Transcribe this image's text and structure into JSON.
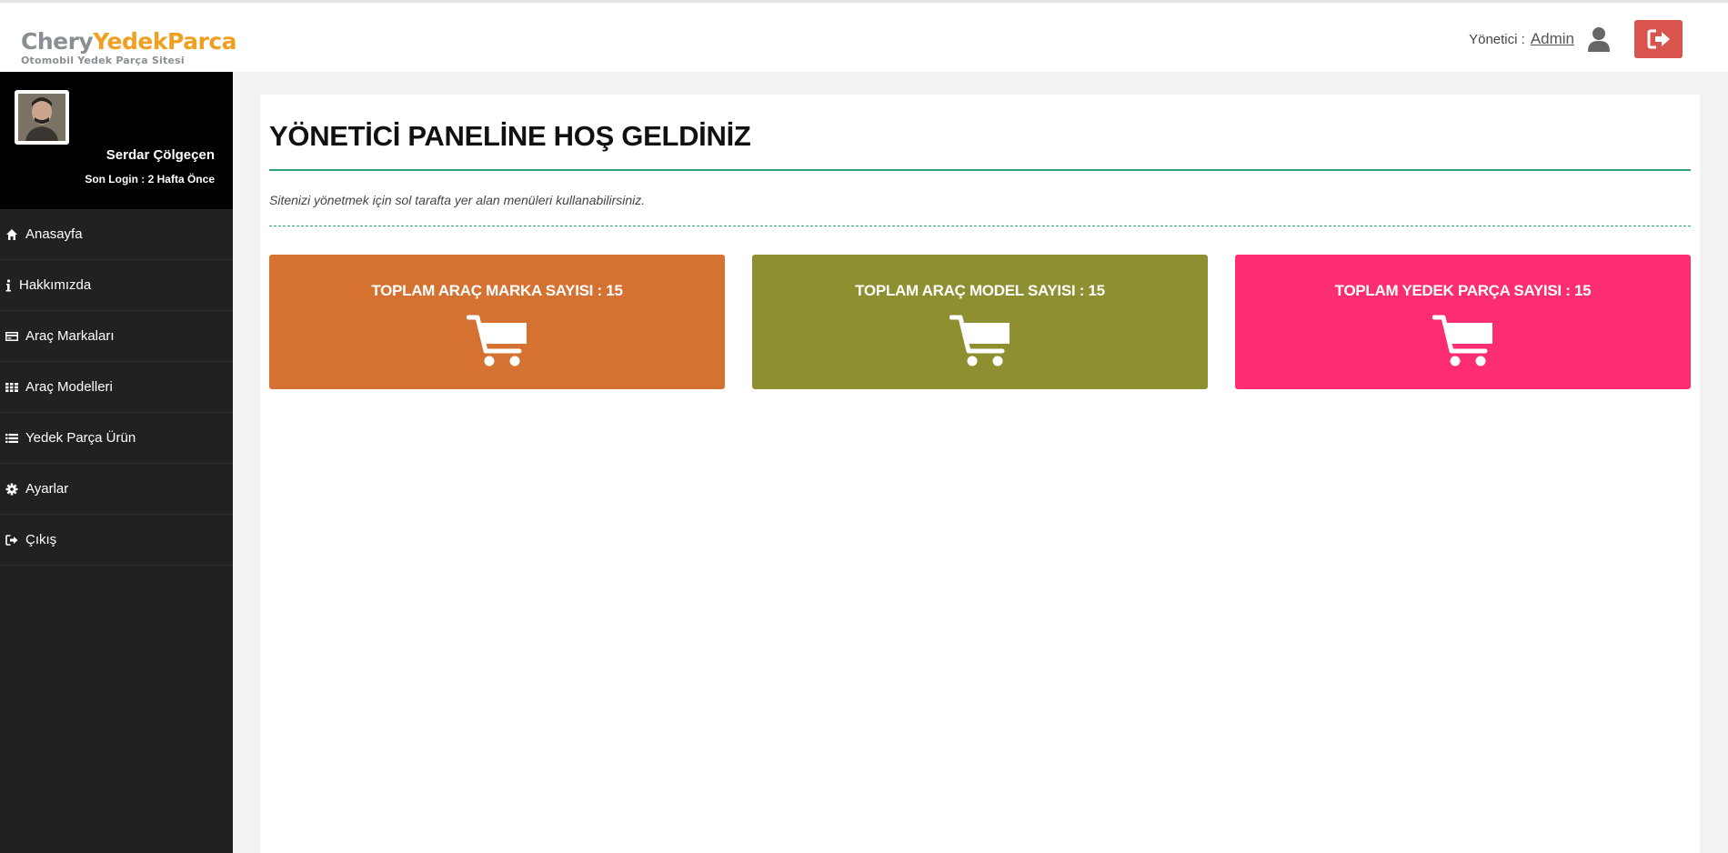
{
  "header": {
    "logo_part1": "Chery",
    "logo_part2": "YedekParca",
    "logo_subtitle": "Otomobil Yedek Parça Sitesi",
    "user_role_label": "Yönetici :",
    "user_name": "Admin",
    "logout_icon": "sign-out-icon"
  },
  "sidebar": {
    "profile_name": "Serdar Çölgeçen",
    "profile_login": "Son Login : 2 Hafta Önce",
    "items": [
      {
        "label": "Anasayfa",
        "icon": "home-icon"
      },
      {
        "label": "Hakkımızda",
        "icon": "info-icon"
      },
      {
        "label": "Araç Markaları",
        "icon": "card-icon"
      },
      {
        "label": "Araç Modelleri",
        "icon": "grid-icon"
      },
      {
        "label": "Yedek Parça Ürün",
        "icon": "list-icon"
      },
      {
        "label": "Ayarlar",
        "icon": "gear-icon"
      },
      {
        "label": "Çıkış",
        "icon": "sign-out-icon"
      }
    ]
  },
  "main": {
    "title": "YÖNETİCİ PANELİNE HOŞ GELDİNİZ",
    "intro": "Sitenizi yönetmek için sol tarafta yer alan menüleri kullanabilirsiniz.",
    "stats": [
      {
        "label": "TOPLAM ARAÇ MARKA SAYISI : 15",
        "color": "#d57232",
        "icon": "cart-icon"
      },
      {
        "label": "TOPLAM ARAÇ MODEL SAYISI : 15",
        "color": "#8d8f31",
        "icon": "cart-icon"
      },
      {
        "label": "TOPLAM YEDEK PARÇA SAYISI : 15",
        "color": "#fd2d71",
        "icon": "cart-icon"
      }
    ]
  },
  "colors": {
    "accent_green": "#2fa47a",
    "logout_red": "#d9534f",
    "sidebar_bg": "#212121"
  }
}
